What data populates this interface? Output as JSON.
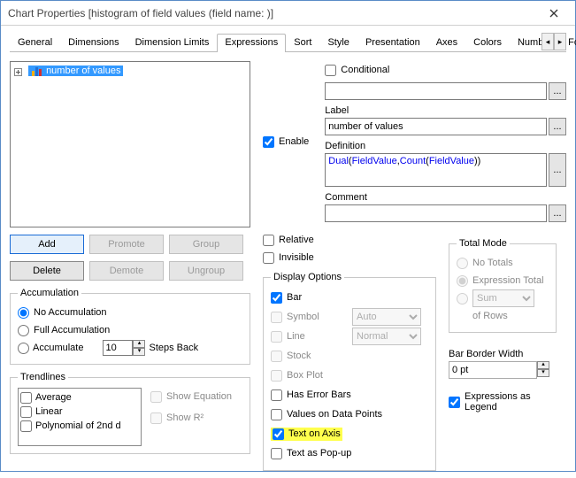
{
  "window": {
    "title": "Chart Properties [histogram of field values (field name: )]"
  },
  "tabs": [
    "General",
    "Dimensions",
    "Dimension Limits",
    "Expressions",
    "Sort",
    "Style",
    "Presentation",
    "Axes",
    "Colors",
    "Number",
    "Font"
  ],
  "active_tab": "Expressions",
  "tree": {
    "node_label": "number of values"
  },
  "buttons": {
    "add": "Add",
    "promote": "Promote",
    "group": "Group",
    "delete": "Delete",
    "demote": "Demote",
    "ungroup": "Ungroup"
  },
  "accumulation": {
    "legend": "Accumulation",
    "no_accum": "No Accumulation",
    "full_accum": "Full Accumulation",
    "accum": "Accumulate",
    "steps_value": "10",
    "steps_back": "Steps Back"
  },
  "trendlines": {
    "legend": "Trendlines",
    "items": [
      "Average",
      "Linear",
      "Polynomial of 2nd d"
    ],
    "show_eq": "Show Equation",
    "show_r2": "Show R²"
  },
  "enable": "Enable",
  "conditional": "Conditional",
  "label_label": "Label",
  "label_value": "number of values",
  "definition_label": "Definition",
  "definition_html_parts": {
    "a": "Dual",
    "b": "(",
    "c": "FieldValue",
    "d": ",",
    "e": "Count",
    "f": "(",
    "g": "FieldValue",
    "h": "))"
  },
  "comment_label": "Comment",
  "relative": "Relative",
  "invisible": "Invisible",
  "display": {
    "legend": "Display Options",
    "bar": "Bar",
    "symbol": "Symbol",
    "symbol_sel": "Auto",
    "line": "Line",
    "line_sel": "Normal",
    "stock": "Stock",
    "boxplot": "Box Plot",
    "errorbars": "Has Error Bars",
    "values_pts": "Values on Data Points",
    "text_axis": "Text on Axis",
    "text_popup": "Text as Pop-up"
  },
  "totalmode": {
    "legend": "Total Mode",
    "no_totals": "No Totals",
    "expr_total": "Expression Total",
    "sum": "Sum",
    "of_rows": "of Rows"
  },
  "bar_border": {
    "label": "Bar Border Width",
    "value": "0 pt"
  },
  "expr_legend": "Expressions as Legend"
}
